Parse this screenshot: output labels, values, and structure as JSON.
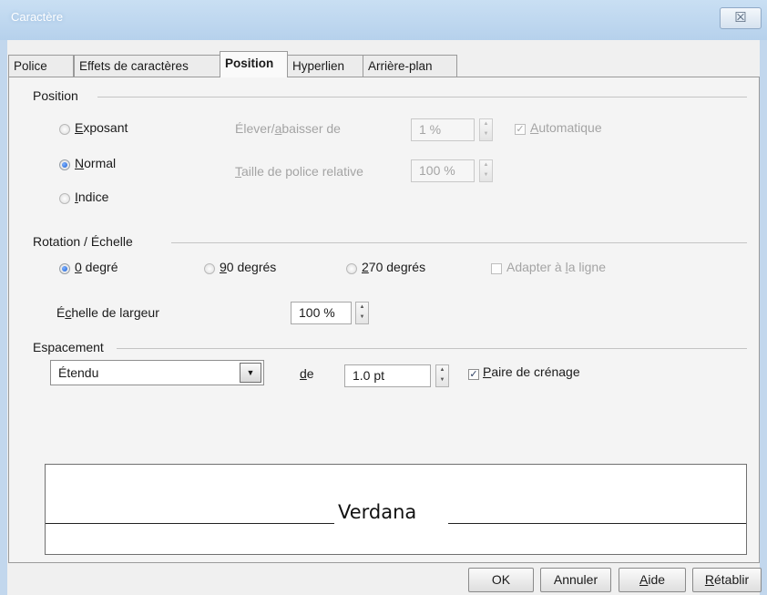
{
  "window": {
    "title": "Caractère",
    "close_symbol": "☒"
  },
  "tabs": [
    {
      "label": "Police"
    },
    {
      "label": "Effets de caractères"
    },
    {
      "label": "Position"
    },
    {
      "label": "Hyperlien"
    },
    {
      "label": "Arrière-plan"
    }
  ],
  "position": {
    "title": "Position",
    "exposant": {
      "ul": "E",
      "rest": "xposant"
    },
    "normal": {
      "ul": "N",
      "rest": "ormal"
    },
    "indice": {
      "ul": "I",
      "rest": "ndice"
    },
    "raise_label": {
      "pre": "Élever/",
      "ul": "a",
      "post": "baisser de"
    },
    "raise_value": "1 %",
    "auto": {
      "ul": "A",
      "rest": "utomatique"
    },
    "size_label": {
      "ul": "T",
      "rest": "aille de police relative"
    },
    "size_value": "100 %"
  },
  "rotation": {
    "title": "Rotation / Échelle",
    "deg0": {
      "ul": "0",
      "rest": " degré"
    },
    "deg90": {
      "ul": "9",
      "rest": "0 degrés"
    },
    "deg270": {
      "ul": "2",
      "rest": "70 degrés"
    },
    "fit": {
      "pre": "Adapter à ",
      "ul": "l",
      "post": "a ligne"
    },
    "scale_label": {
      "pre": "É",
      "ul": "c",
      "post": "helle de largeur"
    },
    "scale_value": "100 %"
  },
  "spacing": {
    "title": "Espacement",
    "selected": "Étendu",
    "de": {
      "ul": "d",
      "rest": "e"
    },
    "value": "1.0 pt",
    "kerning": {
      "ul": "P",
      "rest": "aire de crénage"
    }
  },
  "preview": {
    "text": "Verdana"
  },
  "buttons": {
    "ok": "OK",
    "cancel": "Annuler",
    "help": {
      "ul": "A",
      "rest": "ide"
    },
    "reset": {
      "ul": "R",
      "rest": "établir"
    }
  },
  "state": {
    "position_mode": "Normal",
    "rotation": "0 degré",
    "automatique_checked": true,
    "fit_to_line_checked": false,
    "kerning_checked": true
  }
}
